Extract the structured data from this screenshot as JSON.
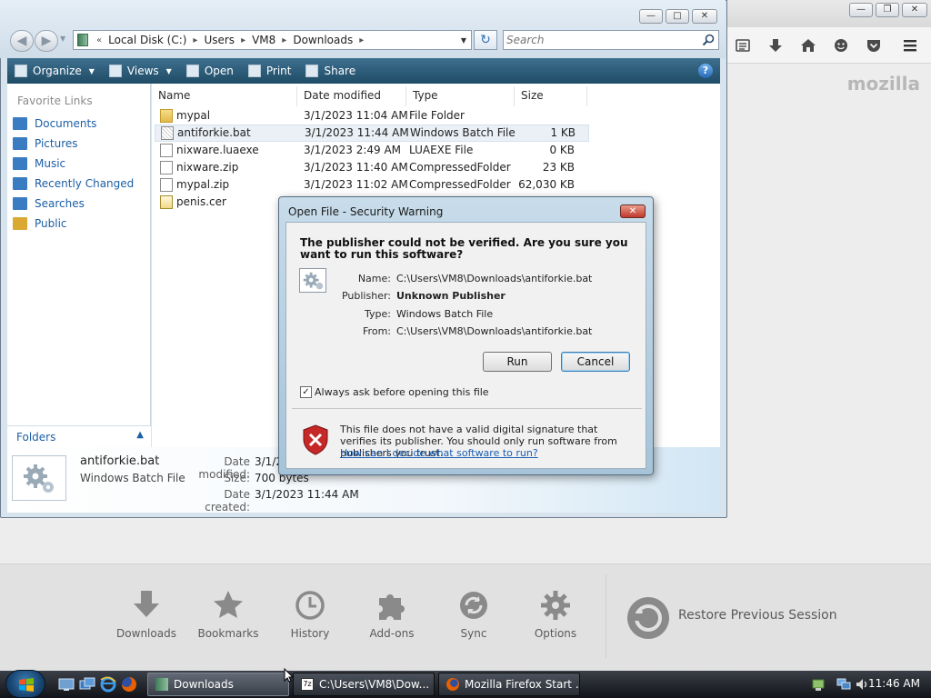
{
  "firefox": {
    "brand": "mozilla",
    "launcher": [
      {
        "label": "Downloads",
        "icon": "download-icon"
      },
      {
        "label": "Bookmarks",
        "icon": "star-icon"
      },
      {
        "label": "History",
        "icon": "clock-icon"
      },
      {
        "label": "Add-ons",
        "icon": "puzzle-icon"
      },
      {
        "label": "Sync",
        "icon": "sync-icon"
      },
      {
        "label": "Options",
        "icon": "gear-icon"
      }
    ],
    "restore_session": "Restore Previous Session"
  },
  "explorer": {
    "breadcrumb": [
      "Local Disk (C:)",
      "Users",
      "VM8",
      "Downloads"
    ],
    "search_placeholder": "Search",
    "commands": [
      "Organize",
      "Views",
      "Open",
      "Print",
      "Share"
    ],
    "favorite_links_heading": "Favorite Links",
    "favorite_links": [
      {
        "label": "Documents",
        "color": "#3a7cc1"
      },
      {
        "label": "Pictures",
        "color": "#3a7cc1"
      },
      {
        "label": "Music",
        "color": "#3a7cc1"
      },
      {
        "label": "Recently Changed",
        "color": "#3a7cc1"
      },
      {
        "label": "Searches",
        "color": "#3a7cc1"
      },
      {
        "label": "Public",
        "color": "#d9a934"
      }
    ],
    "folders_label": "Folders",
    "columns": [
      "Name",
      "Date modified",
      "Type",
      "Size"
    ],
    "files": [
      {
        "name": "mypal",
        "date": "3/1/2023 11:04 AM",
        "type": "File Folder",
        "size": "",
        "kind": "folder"
      },
      {
        "name": "antiforkie.bat",
        "date": "3/1/2023 11:44 AM",
        "type": "Windows Batch File",
        "size": "1 KB",
        "kind": "bat"
      },
      {
        "name": "nixware.luaexe",
        "date": "3/1/2023 2:49 AM",
        "type": "LUAEXE File",
        "size": "0 KB",
        "kind": "file"
      },
      {
        "name": "nixware.zip",
        "date": "3/1/2023 11:40 AM",
        "type": "CompressedFolder",
        "size": "23 KB",
        "kind": "file"
      },
      {
        "name": "mypal.zip",
        "date": "3/1/2023 11:02 AM",
        "type": "CompressedFolder",
        "size": "62,030 KB",
        "kind": "file"
      },
      {
        "name": "penis.cer",
        "date": "",
        "type": "",
        "size": "",
        "kind": "cert"
      }
    ],
    "details": {
      "file_name": "antiforkie.bat",
      "file_type": "Windows Batch File",
      "date_modified_label": "Date modified:",
      "date_modified_value": "3/1/2",
      "size_label": "Size:",
      "size_value": "700 bytes",
      "date_created_label": "Date created:",
      "date_created_value": "3/1/2023 11:44 AM"
    }
  },
  "dialog": {
    "title": "Open File - Security Warning",
    "question": "The publisher could not be verified.  Are you sure you want to run this software?",
    "fields": [
      {
        "label": "Name:",
        "value": "C:\\Users\\VM8\\Downloads\\antiforkie.bat",
        "bold": false
      },
      {
        "label": "Publisher:",
        "value": "Unknown Publisher",
        "bold": true
      },
      {
        "label": "Type:",
        "value": "Windows Batch File",
        "bold": false
      },
      {
        "label": "From:",
        "value": "C:\\Users\\VM8\\Downloads\\antiforkie.bat",
        "bold": false
      }
    ],
    "run_label": "Run",
    "cancel_label": "Cancel",
    "checkbox_label": "Always ask before opening this file",
    "checkbox_checked": true,
    "warning_text": "This file does not have a valid digital signature that verifies its publisher.  You should only run software from publishers you trust.",
    "help_link": "How can I decide what software to run?"
  },
  "taskbar": {
    "buttons": [
      {
        "label": "Downloads",
        "active": true
      },
      {
        "label": "C:\\Users\\VM8\\Dow...",
        "active": false
      },
      {
        "label": "Mozilla Firefox Start ...",
        "active": false
      }
    ],
    "clock": "11:46 AM"
  }
}
